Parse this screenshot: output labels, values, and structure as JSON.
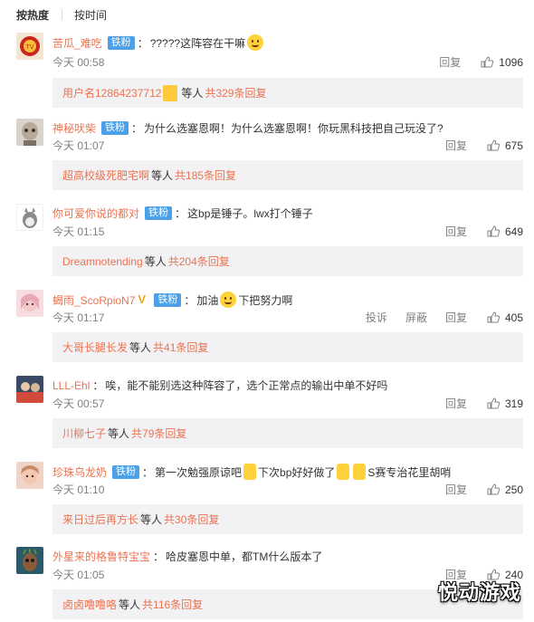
{
  "sort": {
    "hot": "按热度",
    "time": "按时间"
  },
  "comments": [
    {
      "user": "苦瓜_难吃",
      "badge": "铁粉",
      "text_before": "?????这阵容在干嘛",
      "text_after": "",
      "time": "今天 00:58",
      "actions": [
        "回复"
      ],
      "likes": "1096",
      "reply": {
        "name": "用户名12864237712",
        "mid": "等人",
        "count": "共329条回复"
      }
    },
    {
      "user": "神秘吠柴",
      "badge": "铁粉",
      "text_before": "为什么选塞恩啊！为什么选塞恩啊！你玩黑科技把自己玩没了?",
      "text_after": "",
      "time": "今天 01:07",
      "actions": [
        "回复"
      ],
      "likes": "675",
      "reply": {
        "name": "超高校级死肥宅啊",
        "mid": "等人",
        "count": "共185条回复"
      }
    },
    {
      "user": "你可爱你说的都对",
      "badge": "铁粉",
      "text_before": "这bp是锤子。lwx打个锤子",
      "text_after": "",
      "time": "今天 01:15",
      "actions": [
        "回复"
      ],
      "likes": "649",
      "reply": {
        "name": "Dreamnotending",
        "mid": "等人",
        "count": "共204条回复"
      }
    },
    {
      "user": "蝎雨_ScoRpioN7",
      "badge": "铁粉",
      "text_before": "加油",
      "text_after": "下把努力啊",
      "time": "今天 01:17",
      "actions": [
        "投诉",
        "屏蔽",
        "回复"
      ],
      "likes": "405",
      "reply": {
        "name": "大哥长腿长发",
        "mid": "等人",
        "count": "共41条回复"
      }
    },
    {
      "user": "LLL-Ehl",
      "badge": "",
      "text_before": "唉，能不能别选这种阵容了，选个正常点的输出中单不好吗",
      "text_after": "",
      "time": "今天 00:57",
      "actions": [
        "回复"
      ],
      "likes": "319",
      "reply": {
        "name": "川柳七子",
        "mid": "等人",
        "count": "共79条回复"
      }
    },
    {
      "user": "珍珠乌龙奶",
      "badge": "铁粉",
      "text_before": "第一次勉强原谅吧",
      "text_mid": "下次bp好好做了",
      "text_after": "S赛专治花里胡哨",
      "time": "今天 01:10",
      "actions": [
        "回复"
      ],
      "likes": "250",
      "reply": {
        "name": "来日过后再方长",
        "mid": "等人",
        "count": "共30条回复"
      }
    },
    {
      "user": "外星来的格鲁特宝宝",
      "badge": "",
      "text_before": "哈皮塞恩中单，都TM什么版本了",
      "text_after": "",
      "time": "今天 01:05",
      "actions": [
        "回复"
      ],
      "likes": "240",
      "reply": {
        "name": "卤卤噜噜咯",
        "mid": "等人",
        "count": "共116条回复"
      }
    }
  ],
  "watermark": "悦动游戏",
  "colors": {
    "username": "#eb7350",
    "badge": "#4ba0e8",
    "reply_bg": "#f2f2f5"
  }
}
